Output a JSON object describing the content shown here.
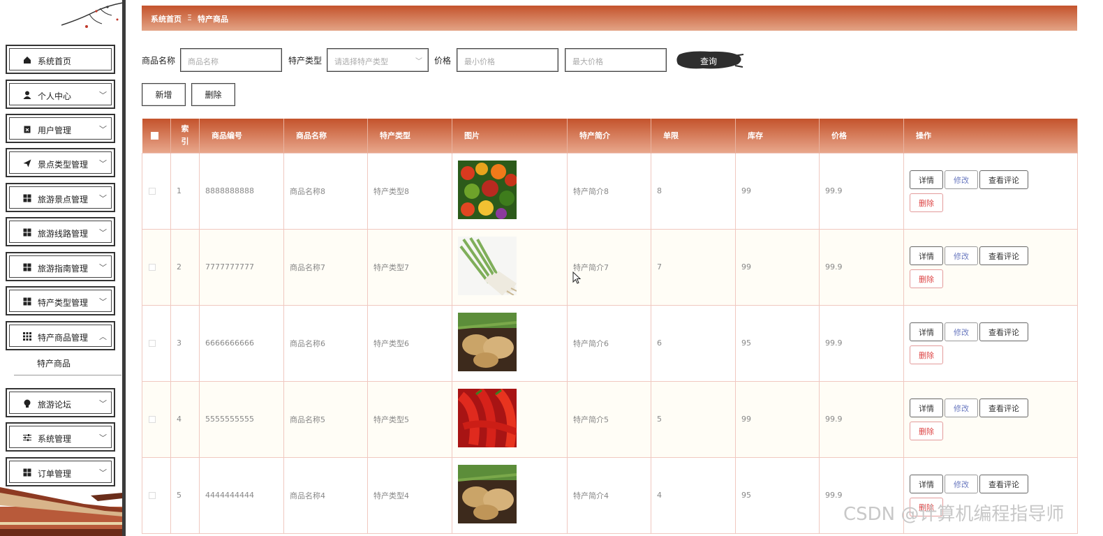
{
  "sidebar": {
    "items": [
      {
        "label": "系统首页",
        "icon": "home-icon",
        "chevron": false
      },
      {
        "label": "个人中心",
        "icon": "user-icon",
        "chevron": true
      },
      {
        "label": "用户管理",
        "icon": "clipboard-icon",
        "chevron": true
      },
      {
        "label": "景点类型管理",
        "icon": "send-icon",
        "chevron": true
      },
      {
        "label": "旅游景点管理",
        "icon": "grid-icon",
        "chevron": true
      },
      {
        "label": "旅游线路管理",
        "icon": "grid-icon",
        "chevron": true
      },
      {
        "label": "旅游指南管理",
        "icon": "grid-icon",
        "chevron": true
      },
      {
        "label": "特产类型管理",
        "icon": "grid-icon",
        "chevron": true
      },
      {
        "label": "特产商品管理",
        "icon": "apps-icon",
        "chevron": true
      },
      {
        "label": "旅游论坛",
        "icon": "bulb-icon",
        "chevron": true
      },
      {
        "label": "系统管理",
        "icon": "sliders-icon",
        "chevron": true
      },
      {
        "label": "订单管理",
        "icon": "grid-icon",
        "chevron": true
      }
    ],
    "submenu_label": "特产商品"
  },
  "breadcrumb": {
    "home": "系统首页",
    "separator": "Ξ",
    "current": "特产商品"
  },
  "filters": {
    "name_label": "商品名称",
    "name_placeholder": "商品名称",
    "type_label": "特产类型",
    "type_placeholder": "请选择特产类型",
    "price_label": "价格",
    "min_placeholder": "最小价格",
    "max_placeholder": "最大价格",
    "query_label": "查询"
  },
  "actions": {
    "add": "新增",
    "delete": "删除"
  },
  "table": {
    "headers": [
      "索引",
      "商品编号",
      "商品名称",
      "特产类型",
      "图片",
      "特产简介",
      "单限",
      "库存",
      "价格",
      "操作"
    ],
    "row_buttons": {
      "detail": "详情",
      "edit": "修改",
      "review": "查看评论",
      "delete": "删除"
    },
    "rows": [
      {
        "index": "1",
        "code": "8888888888",
        "name": "商品名称8",
        "type": "特产类型8",
        "image": "vegetables",
        "intro": "特产简介8",
        "limit": "8",
        "stock": "99",
        "price": "99.9"
      },
      {
        "index": "2",
        "code": "7777777777",
        "name": "商品名称7",
        "type": "特产类型7",
        "image": "scallion",
        "intro": "特产简介7",
        "limit": "7",
        "stock": "99",
        "price": "99.9"
      },
      {
        "index": "3",
        "code": "6666666666",
        "name": "商品名称6",
        "type": "特产类型6",
        "image": "potato",
        "intro": "特产简介6",
        "limit": "6",
        "stock": "95",
        "price": "99.9"
      },
      {
        "index": "4",
        "code": "5555555555",
        "name": "商品名称5",
        "type": "特产类型5",
        "image": "pepper",
        "intro": "特产简介5",
        "limit": "5",
        "stock": "99",
        "price": "99.9"
      },
      {
        "index": "5",
        "code": "4444444444",
        "name": "商品名称4",
        "type": "特产类型4",
        "image": "potato",
        "intro": "特产简介4",
        "limit": "4",
        "stock": "95",
        "price": "99.9"
      }
    ]
  },
  "watermark": "CSDN @计算机编程指导师",
  "colors": {
    "header_top": "#c4532c",
    "header_bottom": "#e8a78c",
    "border": "#f0c8c0",
    "edit": "#6b7ac0",
    "delete": "#dd4444"
  }
}
